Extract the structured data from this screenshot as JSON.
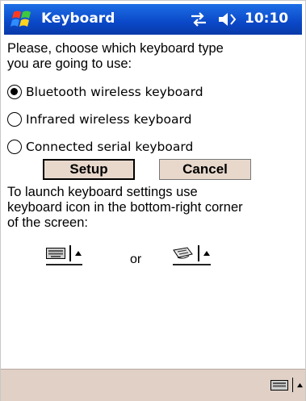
{
  "title_bar": {
    "title": "Keyboard",
    "clock": "10:10",
    "icons": [
      "windows-start-icon",
      "connectivity-icon",
      "speaker-icon"
    ]
  },
  "content": {
    "prompt_line1": "Please, choose which keyboard type",
    "prompt_line2": "you are going to use:",
    "options": [
      {
        "label": "Bluetooth wireless keyboard",
        "selected": true
      },
      {
        "label": "Infrared wireless keyboard",
        "selected": false
      },
      {
        "label": "Connected serial keyboard",
        "selected": false
      }
    ],
    "setup_label": "Setup",
    "cancel_label": "Cancel",
    "launch_line1": "To launch keyboard settings use",
    "launch_line2": "keyboard icon in the bottom-right corner",
    "launch_line3": "of the screen:",
    "or_text": "or"
  },
  "bottom_bar": {
    "icons": [
      "keyboard-icon",
      "input-arrow-icon"
    ]
  },
  "colors": {
    "title_bar": "#0a48c8",
    "button_face": "#e8d8cc",
    "bottom_bar": "#e0d0c6"
  }
}
